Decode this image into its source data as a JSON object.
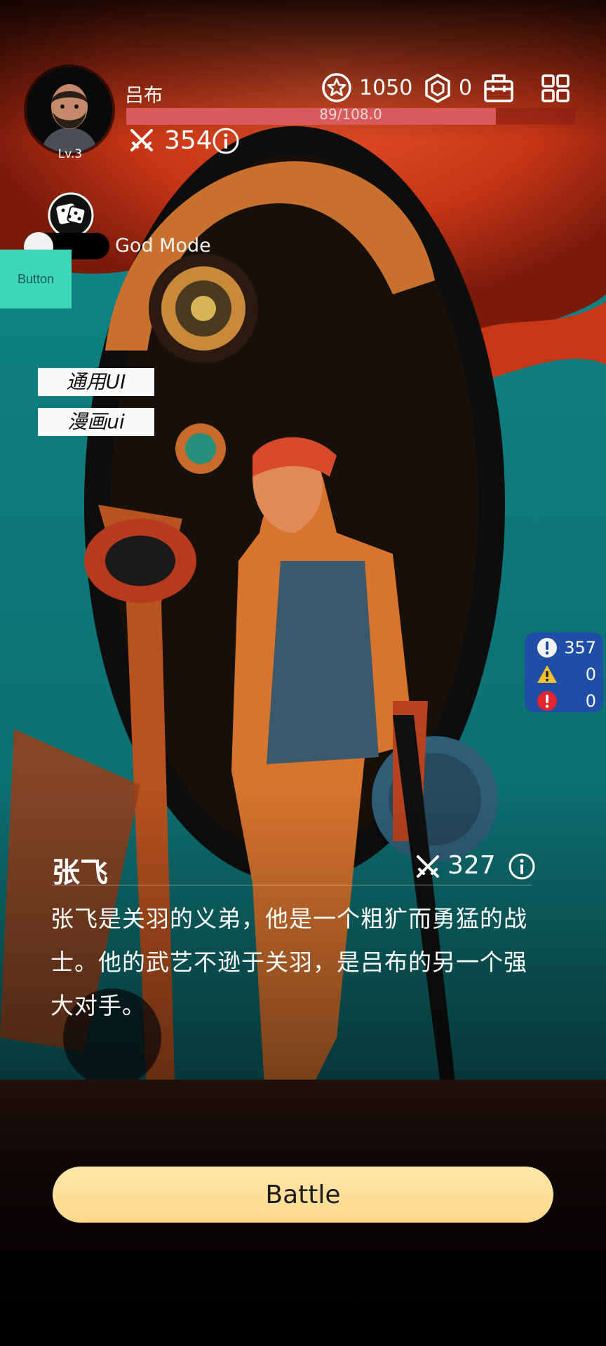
{
  "player": {
    "name": "吕布",
    "level": "Lv.3",
    "hp_text": "89/108.0",
    "hp_fraction": 0.824,
    "power": "354"
  },
  "currency": {
    "coins": "1050",
    "gems": "0"
  },
  "god_mode": {
    "label": "God Mode",
    "enabled": false
  },
  "debug_button_label": "Button",
  "menu": {
    "general_ui": "通用UI",
    "comic_ui": "漫画ui"
  },
  "log_counts": {
    "info": "357",
    "warning": "0",
    "error": "0"
  },
  "hero": {
    "name": "张飞",
    "power": "327",
    "description": "张飞是关羽的义弟，他是一个粗犷而勇猛的战士。他的武艺不逊于关羽，是吕布的另一个强大对手。"
  },
  "battle_label": "Battle",
  "icons": {
    "coin": "star-coin-icon",
    "gem": "hexagon-gem-icon",
    "shop": "shop-icon",
    "menu": "grid-menu-icon",
    "power": "crossed-swords-icon",
    "info": "info-icon",
    "dice": "dice-icon"
  },
  "colors": {
    "hp_fill": "#d85a5a",
    "battle_button": "#fdd88c",
    "debug_button": "#3cd6b8",
    "log_panel": "#1f4ea6",
    "sky_red": "#d8401c",
    "sky_teal": "#16767a"
  }
}
